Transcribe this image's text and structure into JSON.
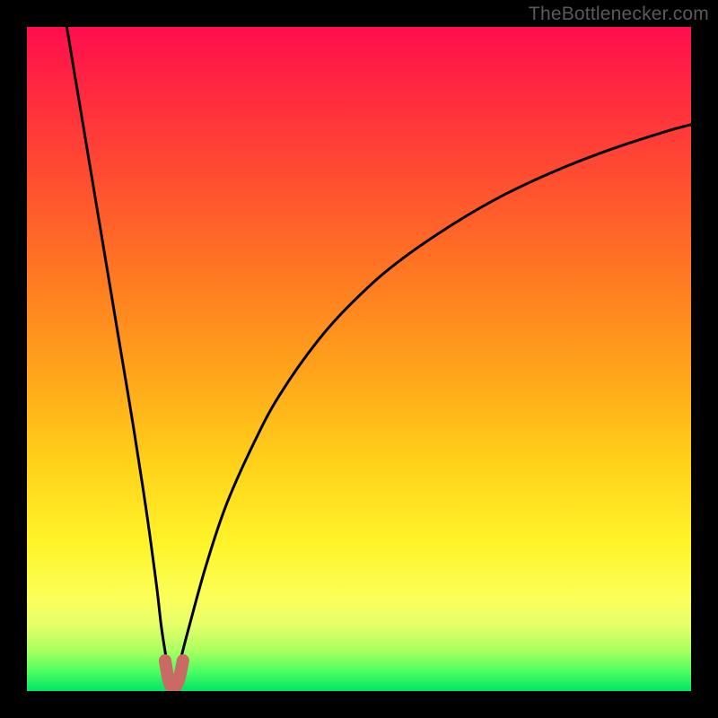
{
  "watermark": "TheBottlenecker.com",
  "colors": {
    "curve": "#000000",
    "dip_marker": "#c96a64"
  },
  "chart_data": {
    "type": "line",
    "title": "",
    "xlabel": "",
    "ylabel": "",
    "xlim": [
      0,
      100
    ],
    "ylim": [
      0,
      100
    ],
    "x_at_min": 22,
    "series": [
      {
        "name": "left-branch",
        "x": [
          6,
          8,
          10,
          12,
          14,
          16,
          18,
          19.5,
          20.2,
          20.8,
          21.3,
          21.7,
          22
        ],
        "values": [
          100,
          88,
          76,
          64,
          52,
          40,
          27,
          16,
          10,
          6,
          3.2,
          1.5,
          0.5
        ]
      },
      {
        "name": "right-branch",
        "x": [
          22,
          22.5,
          23.2,
          24.5,
          27,
          30,
          34,
          38,
          44,
          50,
          56,
          64,
          72,
          80,
          88,
          96,
          100
        ],
        "values": [
          0.5,
          2,
          5,
          10,
          19,
          28,
          37,
          44.5,
          53,
          59.5,
          64.7,
          70.2,
          74.8,
          78.5,
          81.6,
          84.2,
          85.3
        ]
      }
    ],
    "dip_marker": {
      "x": [
        20.8,
        21.3,
        21.8,
        22.3,
        22.9,
        23.5
      ],
      "values": [
        4.6,
        1.8,
        0.6,
        0.6,
        1.8,
        4.6
      ]
    }
  }
}
